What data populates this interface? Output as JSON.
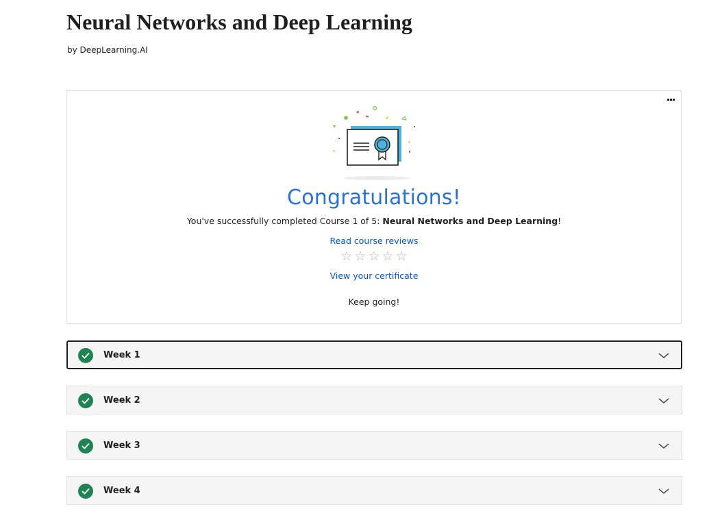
{
  "course": {
    "title": "Neural Networks and Deep Learning",
    "byline": "by DeepLearning.AI"
  },
  "congrats": {
    "heading": "Congratulations!",
    "completion_prefix": "You've successfully completed Course 1 of 5: ",
    "course_name": "Neural Networks and Deep Learning",
    "completion_suffix": "!",
    "reviews_link": "Read course reviews",
    "rating": {
      "filled": 0,
      "max": 5
    },
    "certificate_link": "View your certificate",
    "keep_going": "Keep going!",
    "menu_icon": "more-horizontal-icon"
  },
  "weeks": [
    {
      "label": "Week 1",
      "completed": true,
      "focused": true
    },
    {
      "label": "Week 2",
      "completed": true,
      "focused": false
    },
    {
      "label": "Week 3",
      "completed": true,
      "focused": false
    },
    {
      "label": "Week 4",
      "completed": true,
      "focused": false
    }
  ],
  "colors": {
    "accent": "#2a73cc",
    "link": "#0056d2",
    "success": "#1f8354",
    "row_bg": "#f5f5f5"
  }
}
